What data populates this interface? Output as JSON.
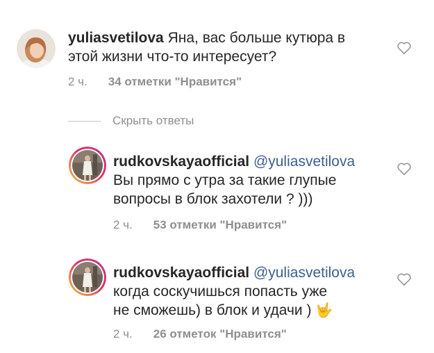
{
  "comments": [
    {
      "username": "yuliasvetilova",
      "mention": "",
      "line1": " Яна, вас больше кутюра в",
      "line2": "этой жизни что-то интересует?",
      "line3": "",
      "time": "2 ч.",
      "likes": "34 отметки \"Нравится\"",
      "icon": "heart-outline-icon"
    }
  ],
  "hide_replies": {
    "label": "Скрыть ответы"
  },
  "replies": [
    {
      "username": "rudkovskayaofficial",
      "mention": "@yuliasvetilova",
      "line1": "Вы прямо с утра за такие глупые",
      "line2": "вопросы в блок захотели ? )))",
      "time": "2 ч.",
      "likes": "53 отметки \"Нравится\"",
      "icon": "heart-outline-icon"
    },
    {
      "username": "rudkovskayaofficial",
      "mention": "@yuliasvetilova",
      "line1": "когда соскучишься попасть уже",
      "line2": "не сможешь) в блок и удачи )",
      "emoji": "🤟",
      "time": "2 ч.",
      "likes": "26 отметок \"Нравится\"",
      "icon": "heart-outline-icon"
    }
  ],
  "colors": {
    "text": "#262626",
    "meta": "#8e8e8e",
    "mention": "#3d5f8e"
  }
}
